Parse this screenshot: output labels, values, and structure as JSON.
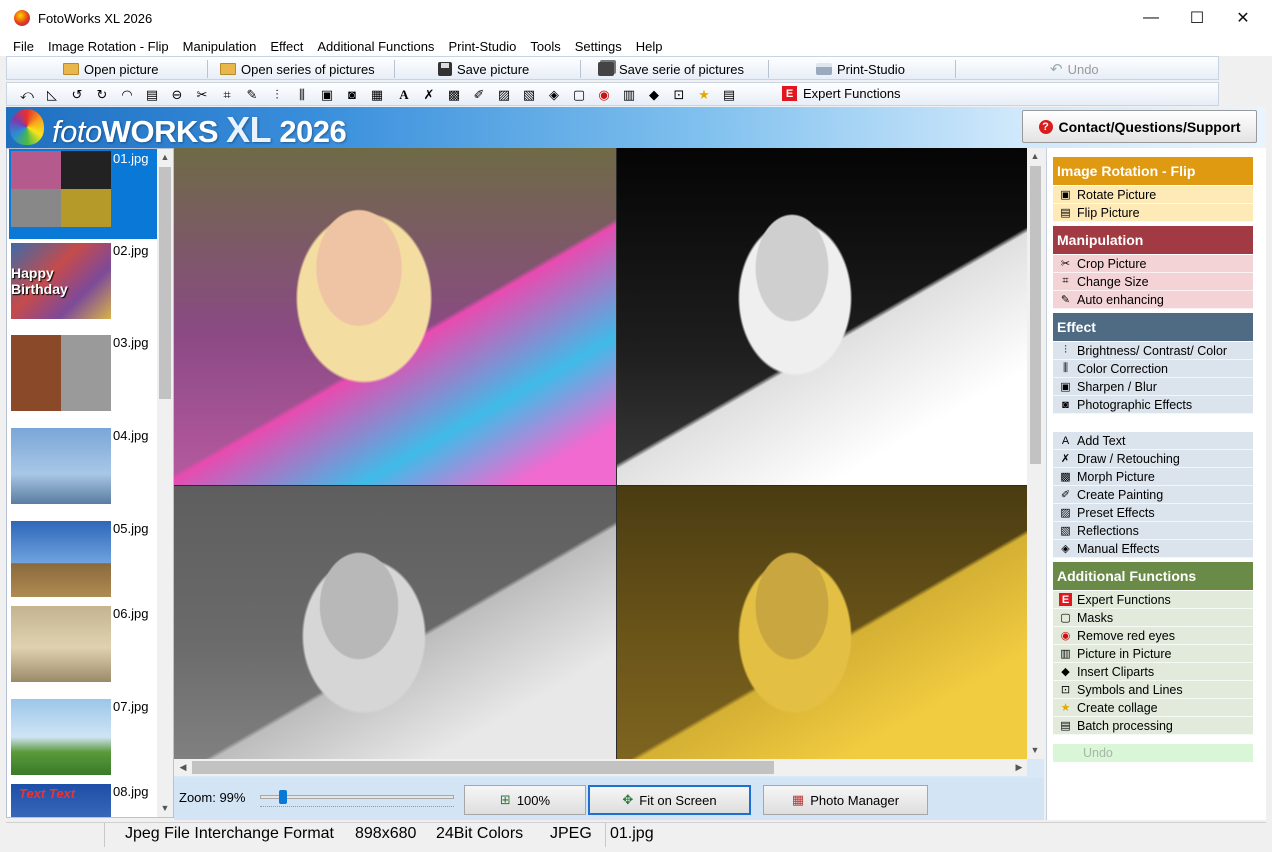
{
  "window": {
    "title": "FotoWorks XL 2026",
    "minimize": "—",
    "maximize": "☐",
    "close": "✕"
  },
  "menu": [
    "File",
    "Image Rotation - Flip",
    "Manipulation",
    "Effect",
    "Additional Functions",
    "Print-Studio",
    "Tools",
    "Settings",
    "Help"
  ],
  "toolbar": {
    "open_picture": "Open picture",
    "open_series": "Open series of pictures",
    "save_picture": "Save picture",
    "save_series": "Save serie of pictures",
    "print_studio": "Print-Studio",
    "undo": "Undo",
    "expert_functions": "Expert Functions",
    "expert_badge": "E"
  },
  "banner": {
    "logo_foto": "foto",
    "logo_works": "WORKS",
    "logo_xl": "XL",
    "logo_year": "2026",
    "support_label": "Contact/Questions/Support",
    "support_badge": "?"
  },
  "thumbnails": [
    {
      "name": "01.jpg",
      "selected": true
    },
    {
      "name": "02.jpg",
      "selected": false,
      "caption": "Happy Birthday"
    },
    {
      "name": "03.jpg",
      "selected": false
    },
    {
      "name": "04.jpg",
      "selected": false
    },
    {
      "name": "05.jpg",
      "selected": false
    },
    {
      "name": "06.jpg",
      "selected": false
    },
    {
      "name": "07.jpg",
      "selected": false
    },
    {
      "name": "08.jpg",
      "selected": false,
      "caption": "Text Text"
    }
  ],
  "viewer": {
    "zoom_label": "Zoom: 99%",
    "zoom_fraction": 0.1,
    "btn_100": "100%",
    "btn_fit": "Fit on Screen",
    "btn_manager": "Photo Manager"
  },
  "panel": {
    "rotation": {
      "title": "Image Rotation - Flip",
      "color": "#e09a12",
      "bg": "#fdeab6",
      "items": [
        "Rotate Picture",
        "Flip Picture"
      ]
    },
    "manipulation": {
      "title": "Manipulation",
      "color": "#a23a44",
      "bg": "#f3d3d5",
      "items": [
        "Crop Picture",
        "Change Size",
        "Auto enhancing"
      ]
    },
    "effect": {
      "title": "Effect",
      "color": "#4f6b83",
      "bg": "#dbe3ec",
      "items": [
        "Brightness/ Contrast/ Color",
        "Color Correction",
        "Sharpen / Blur",
        "Photographic Effects",
        "",
        "Add Text",
        "Draw / Retouching",
        "Morph Picture",
        "Create Painting",
        "Preset Effects",
        "Reflections",
        "Manual Effects"
      ]
    },
    "additional": {
      "title": "Additional Functions",
      "color": "#6a8a47",
      "bg": "#e1eadb",
      "items": [
        "Expert Functions",
        "Masks",
        "Remove red eyes",
        "Picture in Picture",
        "Insert Cliparts",
        "Symbols and Lines",
        "Create collage",
        "Batch processing"
      ]
    },
    "undo": "Undo"
  },
  "status": {
    "format": "Jpeg File Interchange Format",
    "dimensions": "898x680",
    "colors": "24Bit Colors",
    "type": "JPEG",
    "file": "01.jpg"
  }
}
